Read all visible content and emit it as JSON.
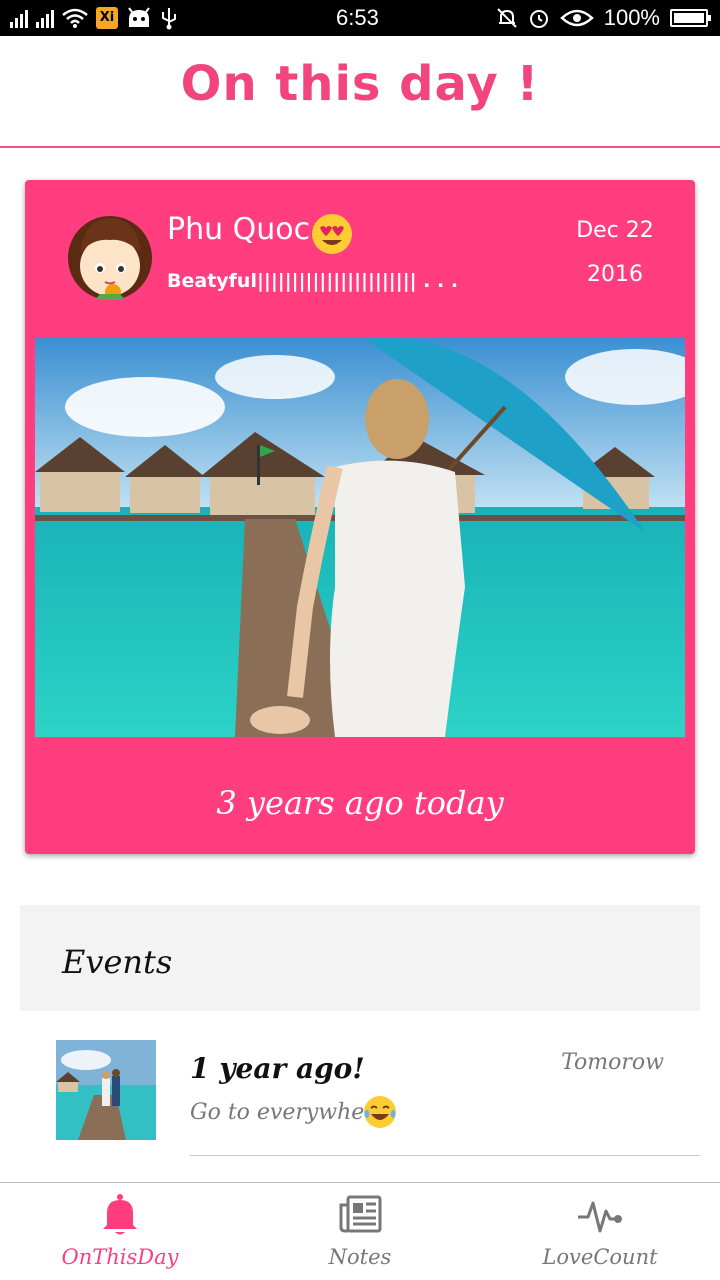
{
  "status_bar": {
    "time": "6:53",
    "battery": "100%",
    "notification_badge": "Xi"
  },
  "header": {
    "title": "On this day !"
  },
  "memory": {
    "place": "Phu Quoc",
    "caption": "Beatyful||||||||||||||||||||||| . . .",
    "date_month_day": "Dec 22",
    "date_year": "2016",
    "ago_label": "3 years ago today",
    "place_emoji": "heart-eyes-emoji"
  },
  "events": {
    "section_title": "Events",
    "items": [
      {
        "title": "1 year ago!",
        "description": "Go to everywhere",
        "when": "Tomorow",
        "emoji": "tears-of-joy-emoji"
      }
    ]
  },
  "bottom_nav": {
    "items": [
      {
        "label": "OnThisDay",
        "icon": "bell-icon",
        "active": true
      },
      {
        "label": "Notes",
        "icon": "newspaper-icon",
        "active": false
      },
      {
        "label": "LoveCount",
        "icon": "heartbeat-icon",
        "active": false
      }
    ]
  },
  "colors": {
    "accent": "#ff3d7f",
    "title_pink": "#f2447d",
    "inactive": "#777777",
    "events_bg": "#f3f3f3"
  }
}
